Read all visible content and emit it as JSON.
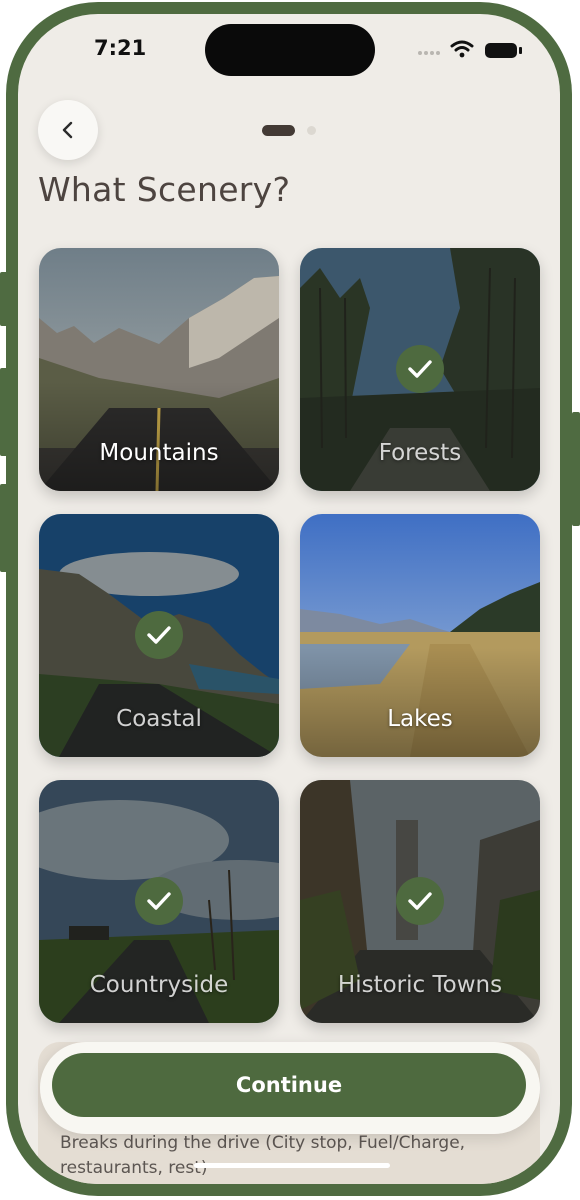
{
  "status_bar": {
    "time": "7:21",
    "icons": [
      "signal-icon",
      "wifi-icon",
      "battery-icon"
    ]
  },
  "header": {
    "back_icon": "chevron-left-icon",
    "page_indicator": {
      "total": 2,
      "current": 1
    }
  },
  "title": "What Scenery?",
  "sceneries": [
    {
      "label": "Mountains",
      "selected": false
    },
    {
      "label": "Forests",
      "selected": true
    },
    {
      "label": "Coastal",
      "selected": true
    },
    {
      "label": "Lakes",
      "selected": false
    },
    {
      "label": "Countryside",
      "selected": true
    },
    {
      "label": "Historic Towns",
      "selected": true
    }
  ],
  "footer": {
    "continue_label": "Continue",
    "partial_text": "Breaks during the drive (City stop, Fuel/Charge, restaurants, rest)"
  },
  "colors": {
    "accent": "#4e6a3f",
    "background": "#efece7",
    "frame": "#4f6b41",
    "title": "#4d4440"
  }
}
